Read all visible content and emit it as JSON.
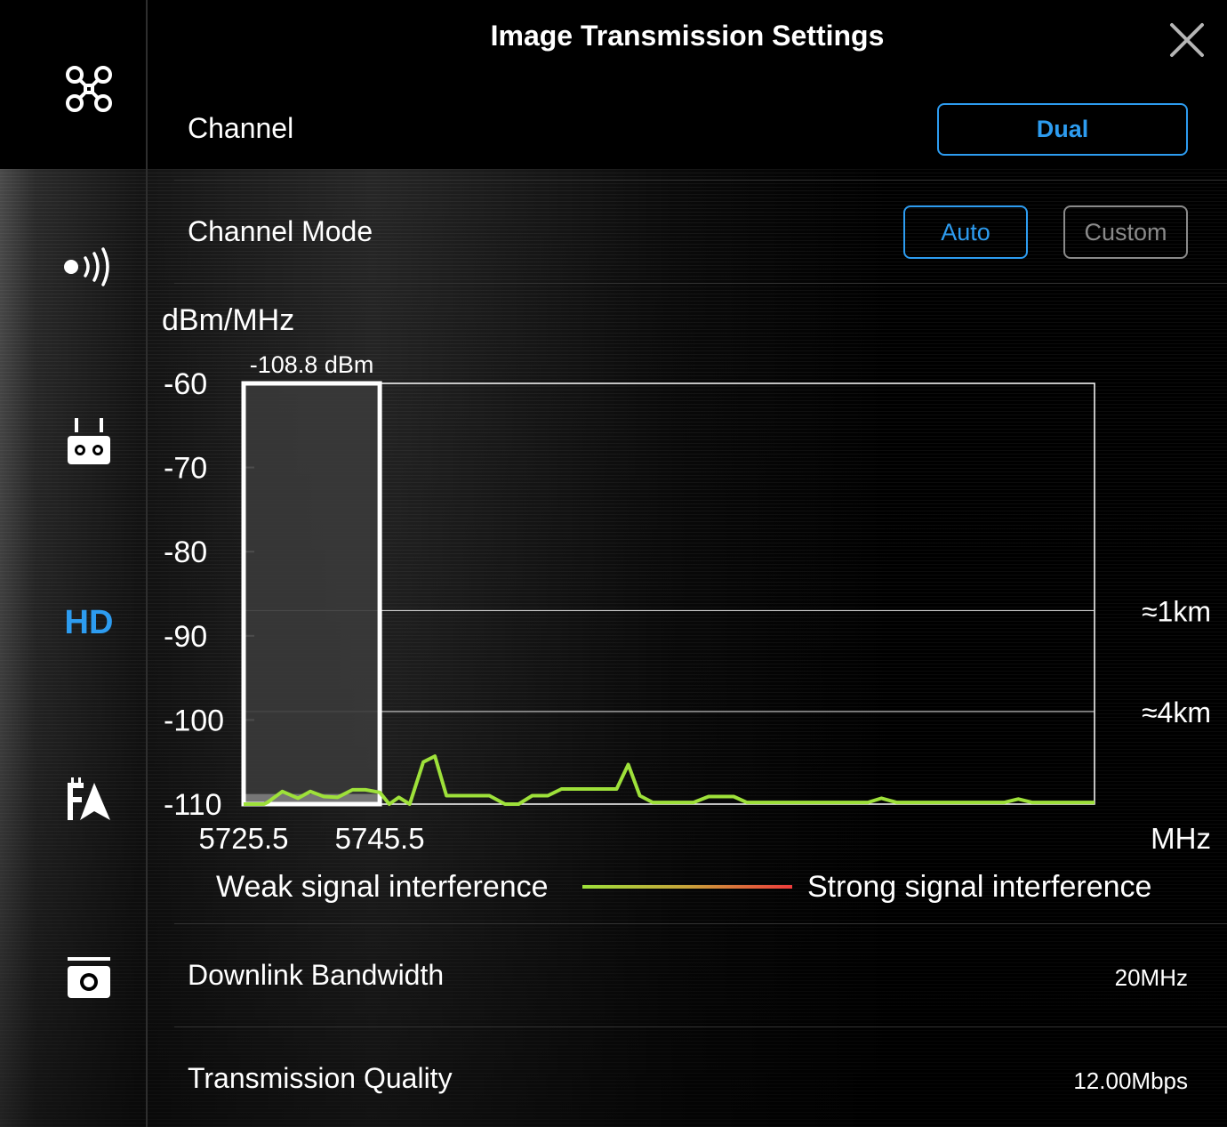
{
  "header": {
    "title": "Image Transmission Settings"
  },
  "sidebar": {
    "items": [
      {
        "icon": "drone-icon"
      },
      {
        "icon": "signal-icon"
      },
      {
        "icon": "remote-controller-icon"
      },
      {
        "icon": "hd-icon",
        "label": "HD",
        "active": true
      },
      {
        "icon": "flight-map-icon"
      },
      {
        "icon": "camera-icon"
      }
    ]
  },
  "settings": {
    "channel": {
      "label": "Channel",
      "value": "Dual"
    },
    "channel_mode": {
      "label": "Channel Mode",
      "options": [
        "Auto",
        "Custom"
      ],
      "selected": "Auto"
    },
    "downlink_bandwidth": {
      "label": "Downlink Bandwidth",
      "value": "20MHz"
    },
    "transmission_quality": {
      "label": "Transmission Quality",
      "value": "12.00Mbps"
    }
  },
  "legend": {
    "weak": "Weak signal interference",
    "strong": "Strong signal interference"
  },
  "colors": {
    "accent": "#2d9cf0",
    "signal_weak": "#9ee13a",
    "signal_strong": "#f03c3c"
  },
  "chart_data": {
    "type": "line",
    "ylabel": "dBm/MHz",
    "xlabel": "MHz",
    "yticks": [
      "-60",
      "-70",
      "-80",
      "-90",
      "-100",
      "-110"
    ],
    "ylim": [
      -110,
      -60
    ],
    "xticks": [
      "5725.5",
      "5745.5"
    ],
    "xlim": [
      5725.5,
      5850.5
    ],
    "selected_band": {
      "from": 5725.5,
      "to": 5745.5,
      "label": "-108.8 dBm",
      "value": -108.8
    },
    "reference_lines": [
      {
        "value": -87,
        "label": "≈1km"
      },
      {
        "value": -99,
        "label": "≈4km"
      }
    ],
    "series": [
      {
        "x": [
          5725.5,
          5728.5,
          5729.0,
          5731.2,
          5733.5,
          5735.3,
          5737.3,
          5739.3,
          5741.5,
          5743.4,
          5745.5,
          5746.9,
          5748.3,
          5749.9,
          5751.9,
          5753.6,
          5755.3,
          5757.3,
          5759.3,
          5761.6,
          5763.9,
          5765.9,
          5767.9,
          5770.2,
          5772.2,
          5774.3,
          5776.4,
          5778.3,
          5780.3,
          5782.0,
          5783.7,
          5785.6,
          5787.6,
          5789.6,
          5791.6,
          5793.8,
          5795.6,
          5797.5,
          5799.4,
          5801.4,
          5803.7,
          5805.4,
          5807.4,
          5809.3,
          5811.3,
          5813.4,
          5815.3,
          5817.2,
          5819.2,
          5821.4,
          5823.4,
          5825.4,
          5827.2,
          5829.2,
          5831.3,
          5833.4,
          5835.5,
          5837.3,
          5839.3,
          5841.3,
          5843.4,
          5845.2,
          5847.1,
          5849.2,
          5850.5
        ],
        "values": [
          -110,
          -110,
          -109.8,
          -108.5,
          -109.3,
          -108.5,
          -109.1,
          -109.2,
          -108.3,
          -108.3,
          -108.6,
          -110,
          -109.2,
          -110,
          -105,
          -104.3,
          -109,
          -109,
          -109,
          -109,
          -110,
          -110,
          -109,
          -109,
          -108.2,
          -108.2,
          -108.2,
          -108.2,
          -108.2,
          -105.3,
          -109,
          -109.8,
          -109.8,
          -109.8,
          -109.8,
          -109.1,
          -109.1,
          -109.1,
          -109.8,
          -109.8,
          -109.8,
          -109.8,
          -109.8,
          -109.8,
          -109.8,
          -109.8,
          -109.8,
          -109.8,
          -109.3,
          -109.8,
          -109.8,
          -109.8,
          -109.8,
          -109.8,
          -109.8,
          -109.8,
          -109.8,
          -109.8,
          -109.4,
          -109.8,
          -109.8,
          -109.8,
          -109.8,
          -109.8,
          -109.8
        ]
      }
    ]
  }
}
